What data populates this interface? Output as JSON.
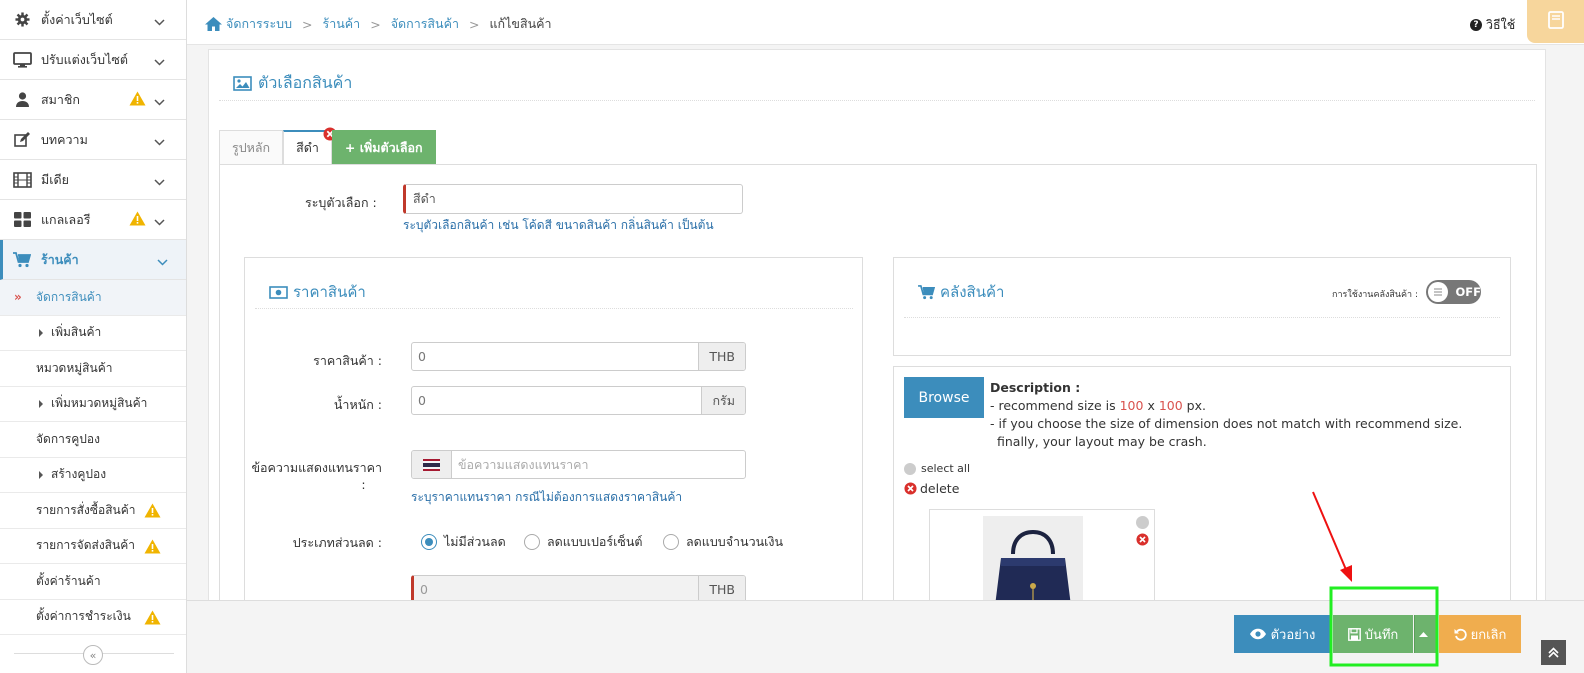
{
  "sidebar": {
    "items": [
      {
        "label": "ตั้งค่าเว็บไซต์",
        "icon": "gear-icon"
      },
      {
        "label": "ปรับแต่งเว็บไซต์",
        "icon": "monitor-icon"
      },
      {
        "label": "สมาชิก",
        "icon": "user-icon"
      },
      {
        "label": "บทความ",
        "icon": "edit-icon"
      },
      {
        "label": "มีเดีย",
        "icon": "film-icon"
      },
      {
        "label": "แกลเลอรี",
        "icon": "grid-icon"
      },
      {
        "label": "ร้านค้า",
        "icon": "cart-icon"
      }
    ],
    "subitems": [
      {
        "label": "จัดการสินค้า"
      },
      {
        "label": "เพิ่มสินค้า"
      },
      {
        "label": "หมวดหมู่สินค้า"
      },
      {
        "label": "เพิ่มหมวดหมู่สินค้า"
      },
      {
        "label": "จัดการคูปอง"
      },
      {
        "label": "สร้างคูปอง"
      },
      {
        "label": "รายการสั่งซื้อสินค้า"
      },
      {
        "label": "รายการจัดส่งสินค้า"
      },
      {
        "label": "ตั้งค่าร้านค้า"
      },
      {
        "label": "ตั้งค่าการชำระเงิน"
      }
    ]
  },
  "breadcrumb": {
    "home": "จัดการระบบ",
    "shop": "ร้านค้า",
    "manage": "จัดการสินค้า",
    "current": "แก้ไขสินค้า"
  },
  "header": {
    "help": "วิธีใช้"
  },
  "card": {
    "title": "ตัวเลือกสินค้า"
  },
  "tabs": {
    "main": "รูปหลัก",
    "color": "สีดำ",
    "add": "+ เพิ่มตัวเลือก"
  },
  "option": {
    "label": "ระบุตัวเลือก :",
    "value": "สีดำ",
    "hint": "ระบุตัวเลือกสินค้า เช่น โค้ดสี ขนาดสินค้า กลิ่นสินค้า เป็นต้น"
  },
  "price_panel": {
    "title": "ราคาสินค้า",
    "price_label": "ราคาสินค้า :",
    "price_value": "0",
    "price_unit": "THB",
    "weight_label": "น้ำหนัก :",
    "weight_value": "0",
    "weight_unit": "กรัม",
    "text_label": "ข้อความแสดงแทนราคา",
    "text_colon": ":",
    "text_placeholder": "ข้อความแสดงแทนราคา",
    "text_hint": "ระบุราคาแทนราคา กรณีไม่ต้องการแสดงราคาสินค้า",
    "discount_label": "ประเภทส่วนลด :",
    "discount_options": [
      "ไม่มีส่วนลด",
      "ลดแบบเปอร์เซ็นต์",
      "ลดแบบจำนวนเงิน"
    ],
    "discount_selected": 0,
    "discount_value": "0",
    "discount_unit": "THB"
  },
  "stock_panel": {
    "title": "คลังสินค้า",
    "toggle_label": "การใช้งานคลังสินค้า :",
    "toggle_state": "OFF"
  },
  "image_panel": {
    "browse": "Browse",
    "desc_title": "Description :",
    "desc_line1_a": "- recommend size is ",
    "desc_w": "100",
    "desc_x": " x ",
    "desc_h": "100",
    "desc_line1_b": " px.",
    "desc_line2": "- if you choose the size of dimension does not match with recommend size.",
    "desc_line3": "finally, your layout may be crash.",
    "select_all": "select all",
    "delete": "delete"
  },
  "actions": {
    "preview": "ตัวอย่าง",
    "save": "บันทึก",
    "cancel": "ยกเลิก"
  },
  "colors": {
    "primary": "#3c8dbc",
    "success": "#6db36d",
    "warning": "#f0ad4e",
    "danger": "#d9534f",
    "highlight": "#22ee22"
  }
}
